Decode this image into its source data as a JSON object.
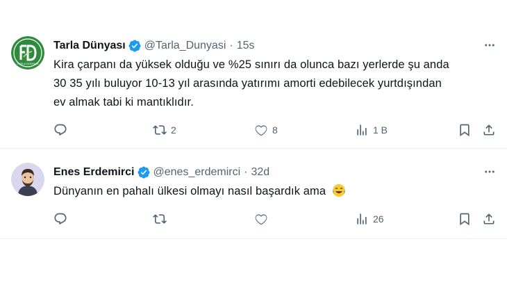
{
  "tweets": [
    {
      "name": "Tarla Dünyası",
      "handle": "@Tarla_Dunyasi",
      "sep": "·",
      "time": "15s",
      "text_lines": [
        "Kira çarpanı da yüksek olduğu ve %25 sınırı da olunca bazı yerlerde şu anda",
        "30 35 yılı buluyor 10-13 yıl arasında yatırımı amorti edebilecek yurtdışından",
        "ev almak tabi ki mantıklıdır."
      ],
      "avatar_text": "TD",
      "avatar_subtext": "TARLA DÜNYASI",
      "retweets": "2",
      "likes": "8",
      "views": "1 B"
    },
    {
      "name": "Enes Erdemirci",
      "handle": "@enes_erdemirci",
      "sep": "·",
      "time": "32d",
      "text": "Dünyanın en pahalı ülkesi olmayı nasıl başardık ama",
      "views": "26"
    }
  ],
  "colors": {
    "verified": "#1d9bf0",
    "text": "#0f1419",
    "muted": "#536471",
    "divider": "#eff3f4",
    "brand_green": "#2e8b3c"
  }
}
